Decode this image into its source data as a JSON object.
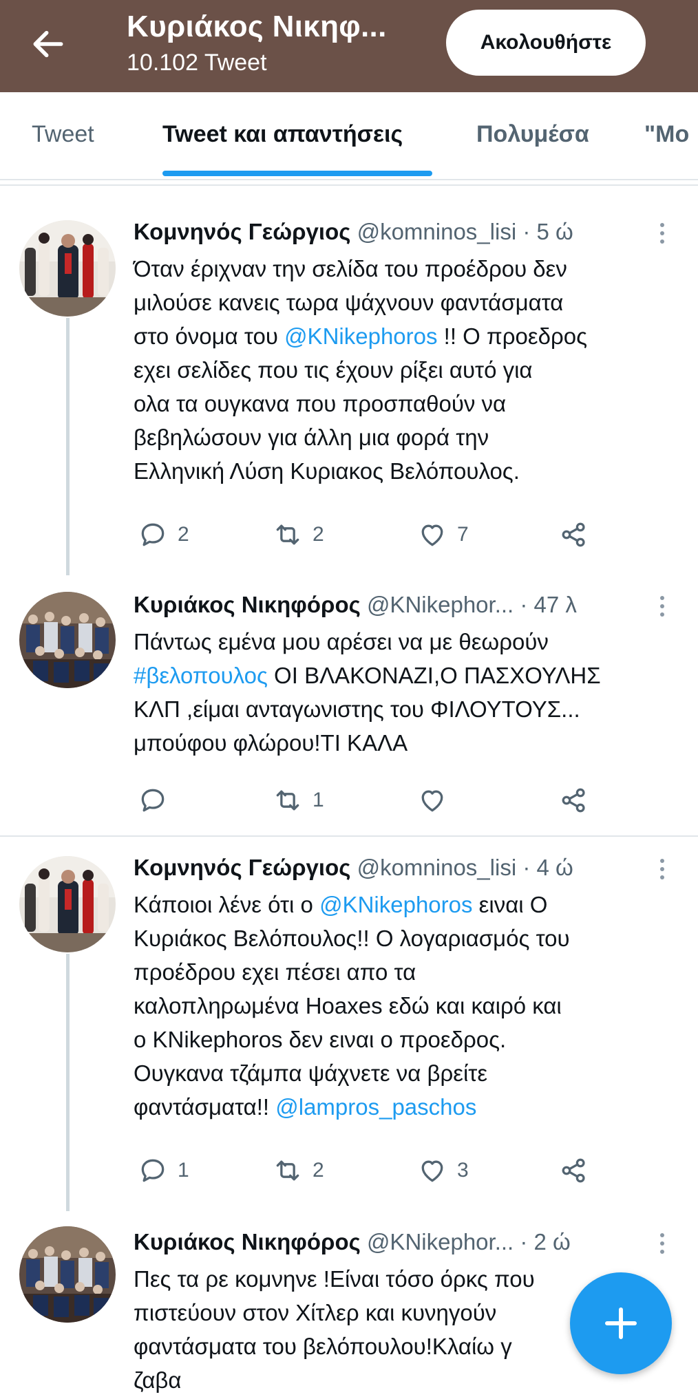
{
  "header": {
    "title": "Κυριάκος Νικηφ...",
    "subtitle": "10.102 Tweet",
    "follow_label": "Ακολουθήστε",
    "bg_color": "#6b5148"
  },
  "tabs": [
    {
      "label": "Tweet",
      "active": false
    },
    {
      "label": "Tweet και απαντήσεις",
      "active": true
    },
    {
      "label": "Πολυμέσα",
      "active": false
    },
    {
      "label": "\"Μο",
      "active": false
    }
  ],
  "tweets": [
    {
      "name": "Κομνηνός Γεώργιος",
      "handle": "@komninos_lisi",
      "time": "· 5 ώ",
      "lines": [
        {
          "text": "Όταν έριχναν την σελίδα του προέδρου δεν"
        },
        {
          "text": "μιλούσε κανεις τωρα ψάχνουν φαντάσματα"
        },
        {
          "pre": "στο όνομα του ",
          "link": "@KNikephoros",
          "post": " !! Ο προεδρος"
        },
        {
          "text": "εχει σελίδες που τις έχουν ρίξει αυτό για"
        },
        {
          "text": "ολα τα ουγκανα που προσπαθούν να"
        },
        {
          "text": "βεβηλώσουν για άλλη μια φορά την"
        },
        {
          "text": "Ελληνική Λύση Κυριακος Βελόπουλος."
        }
      ],
      "replies": "2",
      "retweets": "2",
      "likes": "7"
    },
    {
      "name": "Κυριάκος Νικηφόρος",
      "handle": "@KNikephor...",
      "time": "· 47 λ",
      "lines": [
        {
          "text": "Πάντως εμένα μου αρέσει να με θεωρούν"
        },
        {
          "pre": "",
          "link": "#βελοπουλος",
          "post": " ΟΙ ΒΛΑΚΟΝΑΖΙ,Ο ΠΑΣΧΟΥΛΗΣ"
        },
        {
          "text": "ΚΛΠ ,είμαι ανταγωνιστης του ΦΙΛΟΥΤΟΥΣ..."
        },
        {
          "text": "μπούφου φλώρου!ΤΙ ΚΑΛΑ"
        }
      ],
      "replies": "",
      "retweets": "1",
      "likes": ""
    },
    {
      "name": "Κομνηνός Γεώργιος",
      "handle": "@komninos_lisi",
      "time": "· 4 ώ",
      "lines": [
        {
          "pre": "Κάποιοι λένε ότι ο ",
          "link": "@KNikephoros",
          "post": " ειναι Ο"
        },
        {
          "text": "Κυριάκος Βελόπουλος!! Ο λογαριασμός του"
        },
        {
          "text": "προέδρου εχει πέσει απο τα"
        },
        {
          "text": "καλοπληρωμένα Hoaxes  εδώ και καιρό και"
        },
        {
          "text": "ο KNikephoros δεν ειναι ο προεδρος."
        },
        {
          "text": "Ουγκανα τζάμπα ψάχνετε να βρείτε"
        },
        {
          "pre": "φαντάσματα!! ",
          "link": "@lampros_paschos",
          "post": ""
        }
      ],
      "replies": "1",
      "retweets": "2",
      "likes": "3"
    },
    {
      "name": "Κυριάκος Νικηφόρος",
      "handle": "@KNikephor...",
      "time": "· 2 ώ",
      "lines": [
        {
          "text": "Πες τα ρε κομνηνε !Είναι τόσο όρκς που"
        },
        {
          "text": "πιστεύουν στον Χίτλερ και κυνηγούν"
        },
        {
          "text": "φαντάσματα του βελόπουλου!Κλαίω γ"
        },
        {
          "text": "ζαβα"
        }
      ]
    }
  ],
  "colors": {
    "accent": "#1d9bf0",
    "secondary_text": "#536471"
  }
}
